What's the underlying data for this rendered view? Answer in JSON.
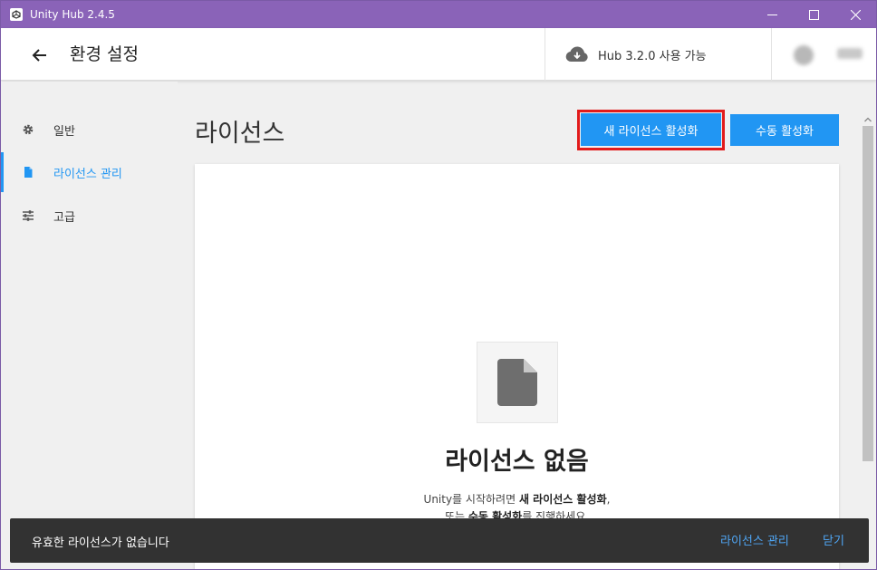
{
  "window": {
    "title": "Unity Hub 2.4.5",
    "colors": {
      "titlebar": "#8a63b8",
      "accent": "#2196f3",
      "highlight": "#e21b1b"
    }
  },
  "header": {
    "title": "환경 설정",
    "update_text": "Hub 3.2.0 사용 가능",
    "icons": [
      "back-arrow-icon",
      "cloud-download-icon"
    ]
  },
  "sidebar": {
    "items": [
      {
        "label": "일반",
        "icon": "gear-icon",
        "active": false
      },
      {
        "label": "라이선스 관리",
        "icon": "file-icon",
        "active": true
      },
      {
        "label": "고급",
        "icon": "sliders-icon",
        "active": false
      }
    ]
  },
  "main": {
    "heading": "라이선스",
    "new_license_button": "새 라이선스 활성화",
    "manual_activation_button": "수동 활성화",
    "empty_state": {
      "title": "라이선스 없음",
      "desc_1_prefix": "Unity를 시작하려면 ",
      "desc_1_bold": "새 라이선스 활성화",
      "desc_1_suffix": ",",
      "desc_2_prefix": "또는 ",
      "desc_2_bold": "수동 활성화",
      "desc_2_suffix": "를 진행하세요."
    }
  },
  "snackbar": {
    "message": "유효한 라이선스가 없습니다",
    "manage_action": "라이선스 관리",
    "close_action": "닫기"
  }
}
